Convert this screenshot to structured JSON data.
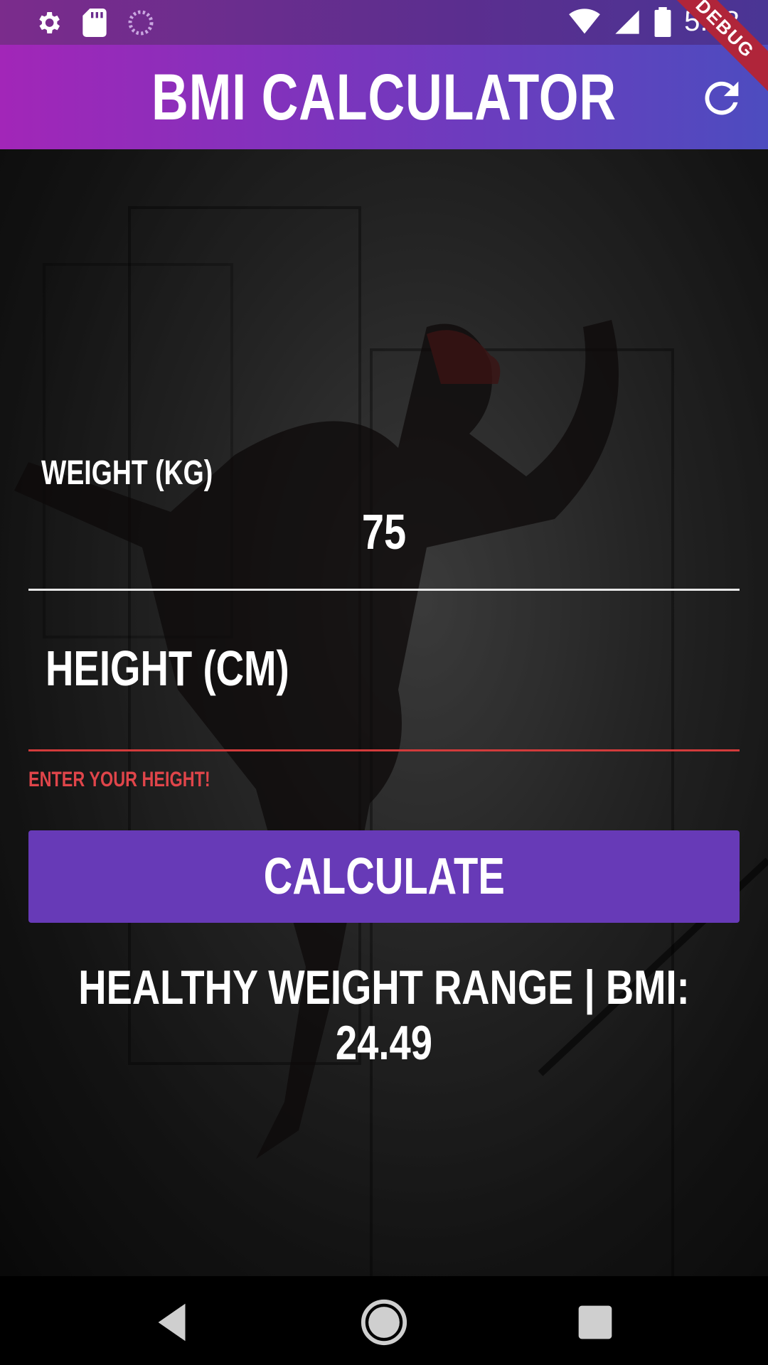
{
  "status_bar": {
    "time": "5:18",
    "icons": [
      "settings-icon",
      "sd-card-icon",
      "progress-circle-icon",
      "wifi-icon",
      "signal-icon",
      "battery-icon"
    ]
  },
  "app_bar": {
    "title": "BMI CALCULATOR",
    "refresh_icon": "refresh-icon",
    "debug_label": "DEBUG"
  },
  "form": {
    "weight_label": "WEIGHT  (KG)",
    "weight_value": "75",
    "height_label": "HEIGHT  (CM)",
    "height_error": "ENTER YOUR HEIGHT!",
    "calculate_label": "CALCULATE"
  },
  "result": {
    "text": "HEALTHY WEIGHT RANGE | BMI: 24.49"
  },
  "nav_bar": {
    "icons": [
      "back-icon",
      "home-icon",
      "recents-icon"
    ]
  },
  "colors": {
    "button": "#673ab7",
    "error": "#d23b3b",
    "appbar_start": "#a226b8",
    "appbar_end": "#4d4cbf"
  }
}
